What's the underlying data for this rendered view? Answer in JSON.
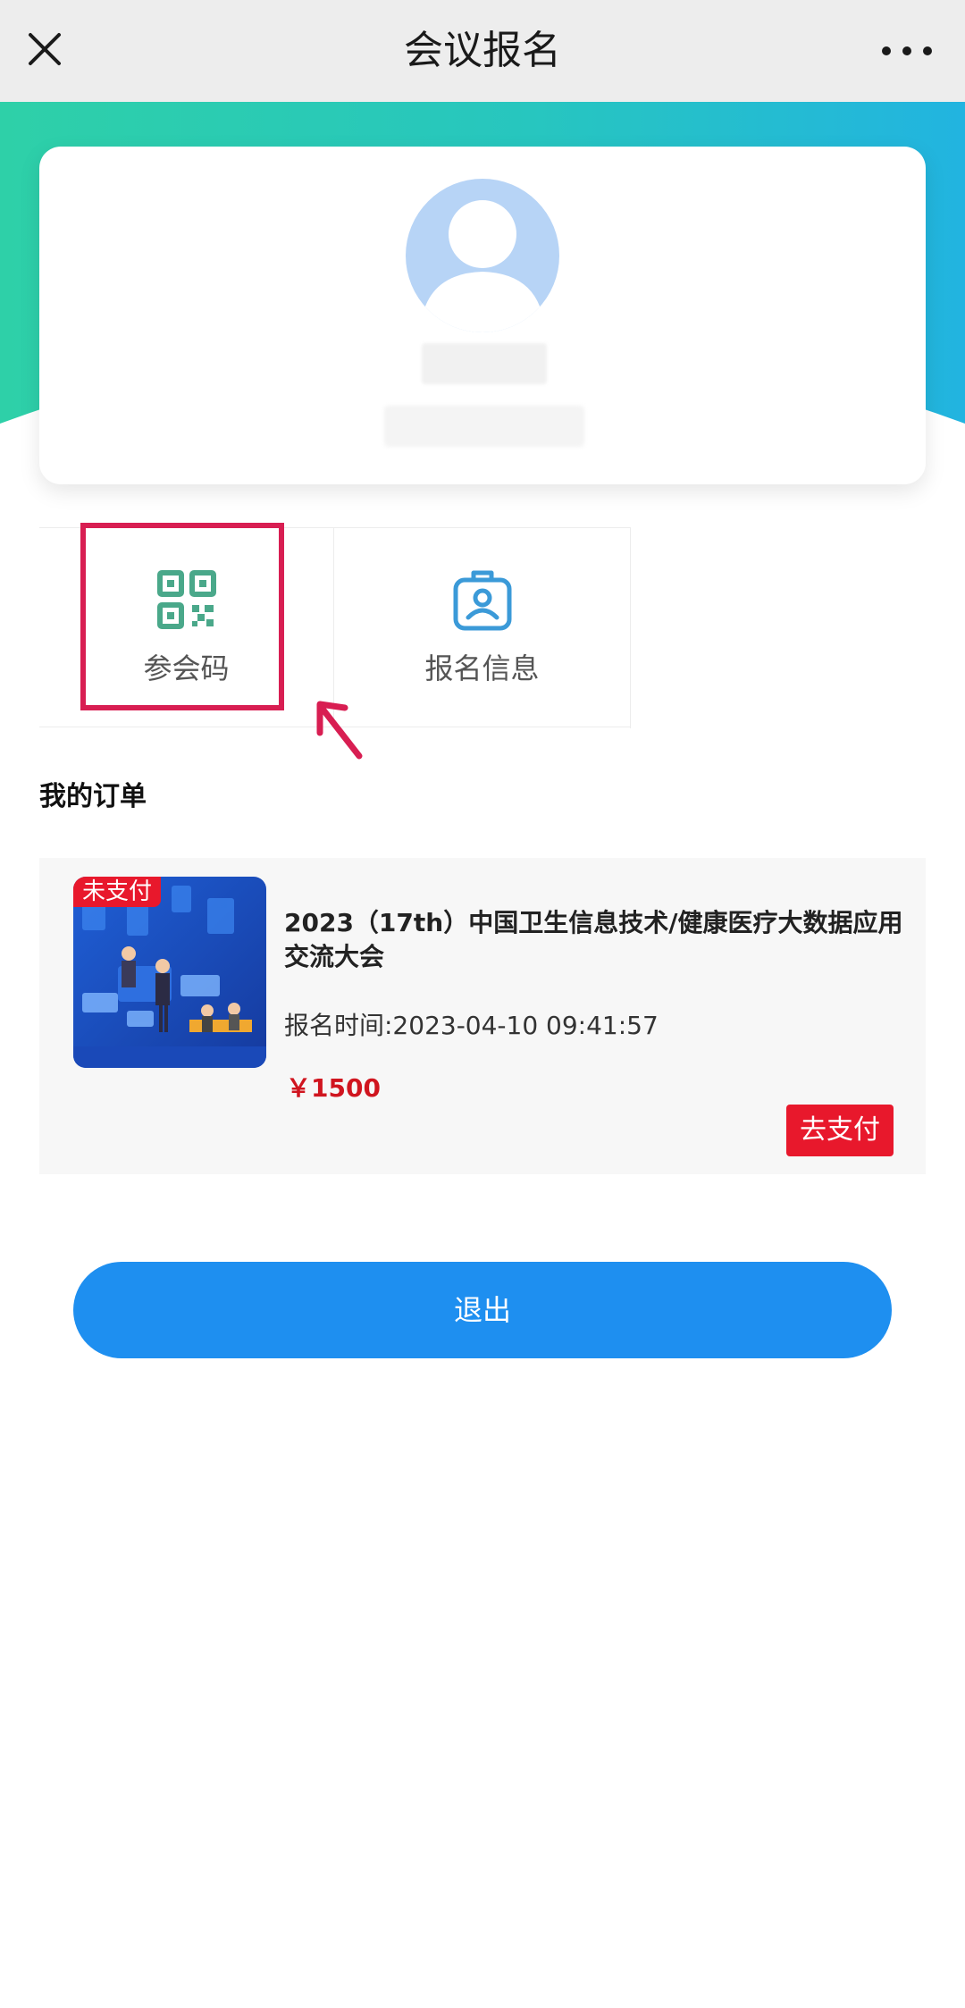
{
  "nav": {
    "title": "会议报名",
    "close_icon": "close-icon",
    "more_icon": "more-icon"
  },
  "profile": {
    "avatar_icon": "avatar-placeholder-icon"
  },
  "tiles": [
    {
      "label": "参会码",
      "icon": "qr-code-icon",
      "highlighted": true
    },
    {
      "label": "报名信息",
      "icon": "badge-icon"
    }
  ],
  "orders": {
    "title": "我的订单",
    "items": [
      {
        "status_tag": "未支付",
        "title": "2023（17th）中国卫生信息技术/健康医疗大数据应用交流大会",
        "time": "报名时间:2023-04-10 09:41:57",
        "price": "￥1500",
        "pay_label": "去支付"
      }
    ]
  },
  "logout_label": "退出",
  "colors": {
    "nav_bg": "#ededed",
    "hero_start": "#2ed0a8",
    "hero_end": "#22b4e0",
    "qr_icon": "#4aa88a",
    "badge_icon": "#3b9ad8",
    "highlight": "#d81e52",
    "price": "#d0151f",
    "tag_red": "#e8182c",
    "logout_blue": "#1e8ff0"
  }
}
